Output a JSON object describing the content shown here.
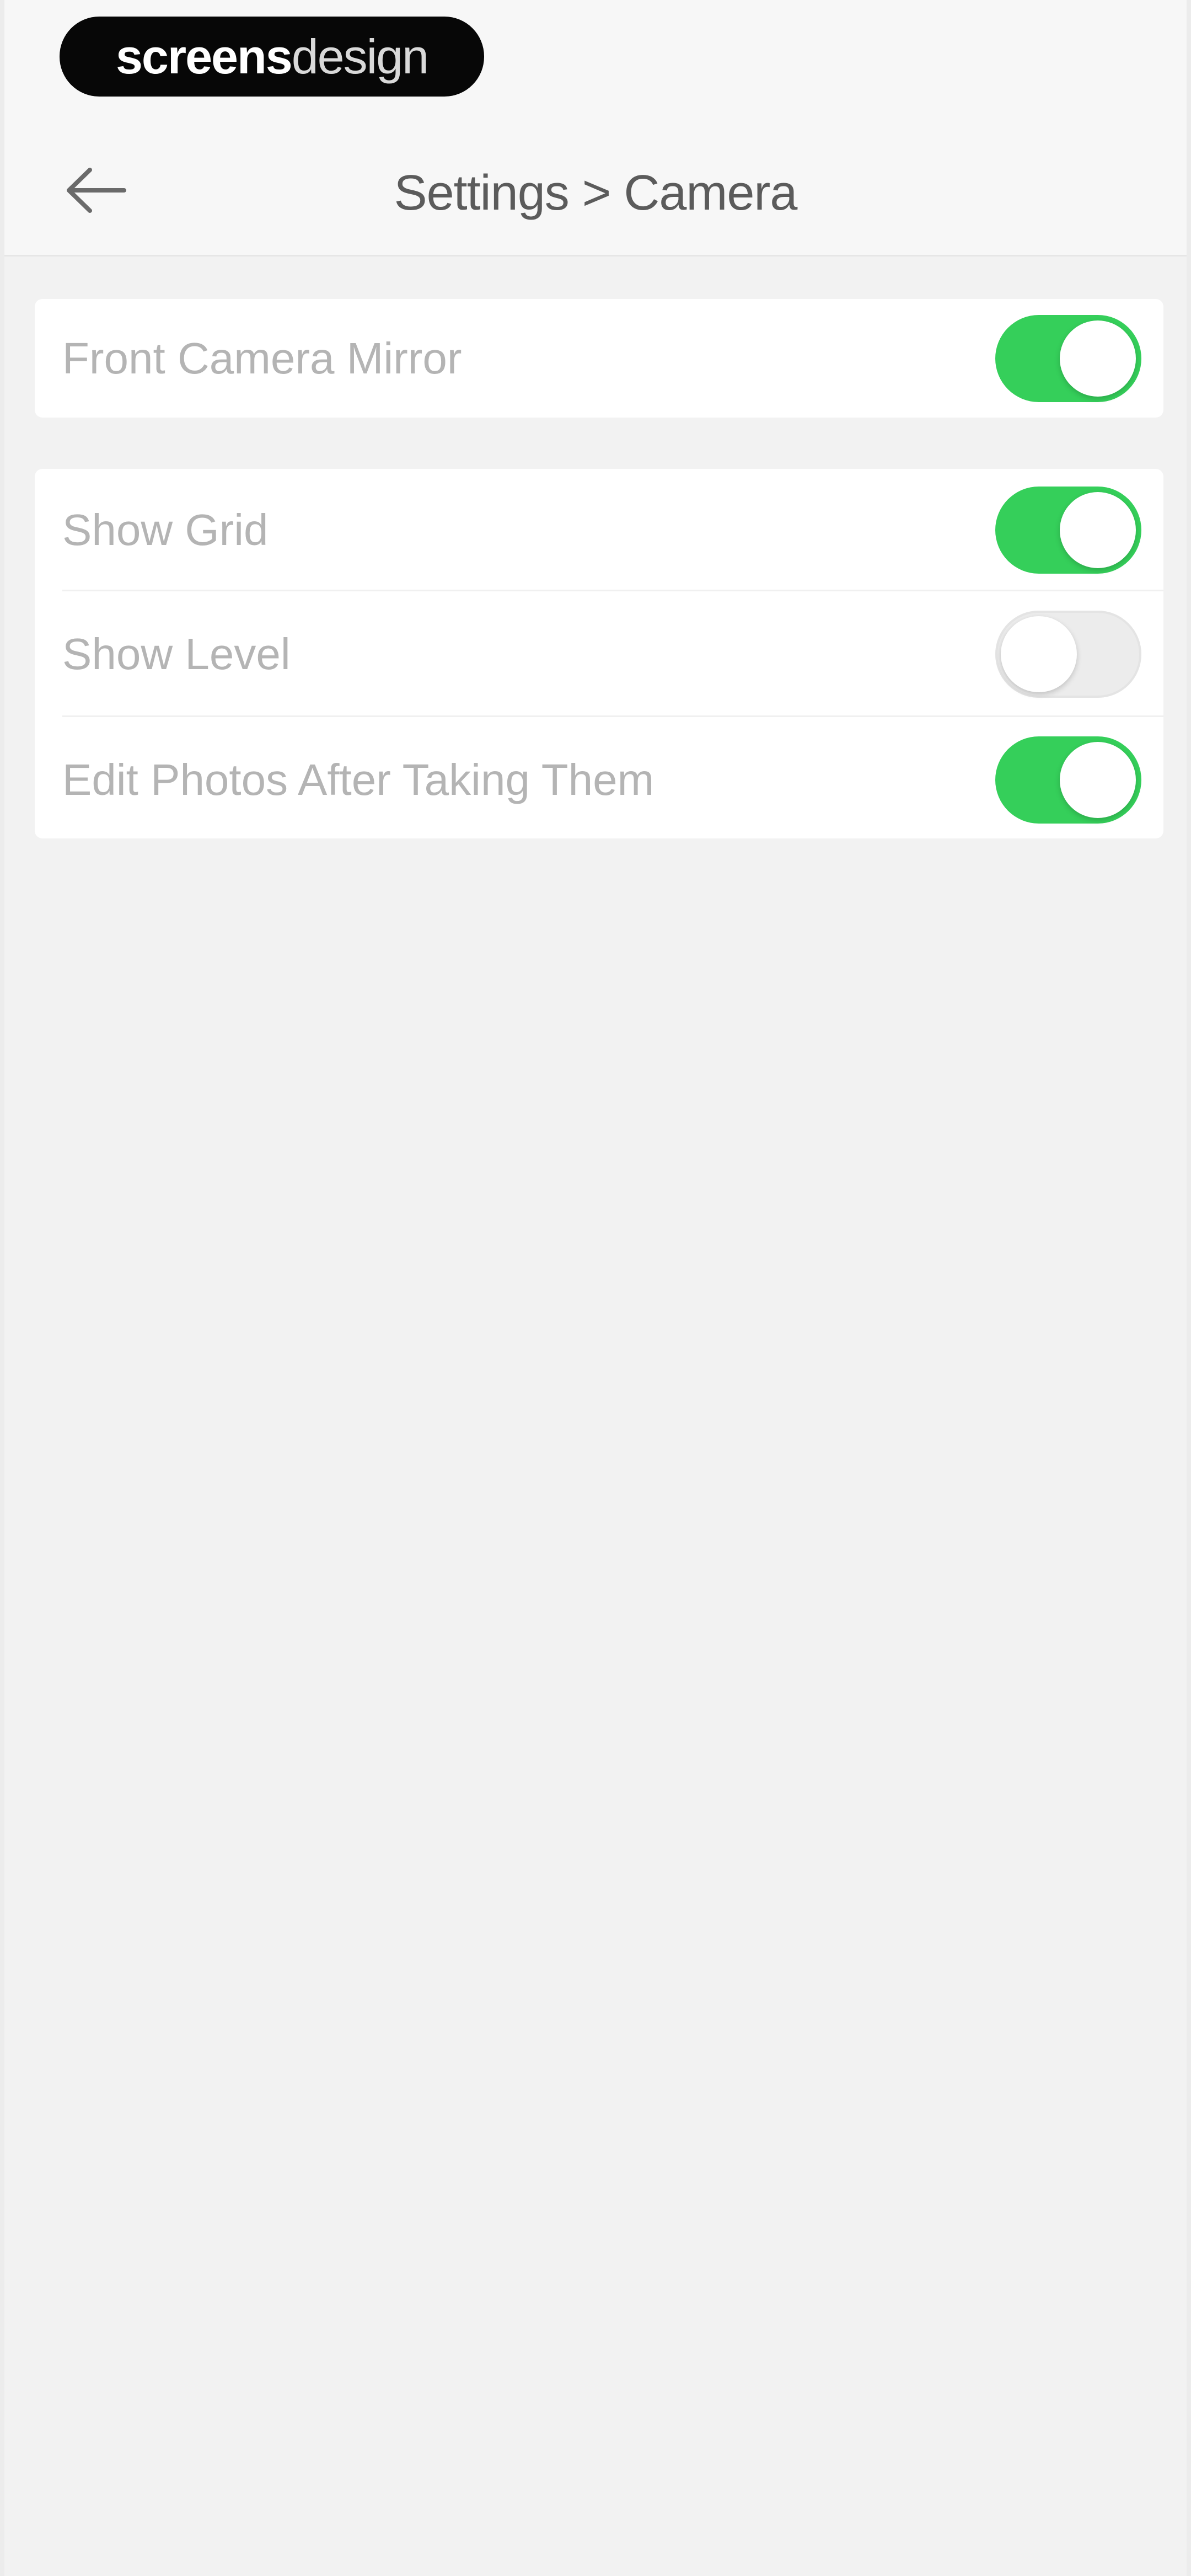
{
  "brand": {
    "bold_text": "screens",
    "light_text": "design"
  },
  "header": {
    "title": "Settings > Camera",
    "back_icon": "arrow-left-icon"
  },
  "colors": {
    "toggle_on": "#35cf5a",
    "toggle_off": "#ececec",
    "label_text": "#b4b4b4",
    "title_text": "#5b5b5b",
    "background": "#f2f2f2"
  },
  "settings": {
    "group1": [
      {
        "label": "Front Camera Mirror",
        "enabled": true
      }
    ],
    "group2": [
      {
        "label": "Show Grid",
        "enabled": true
      },
      {
        "label": "Show Level",
        "enabled": false
      },
      {
        "label": "Edit Photos After Taking Them",
        "enabled": true
      }
    ]
  }
}
